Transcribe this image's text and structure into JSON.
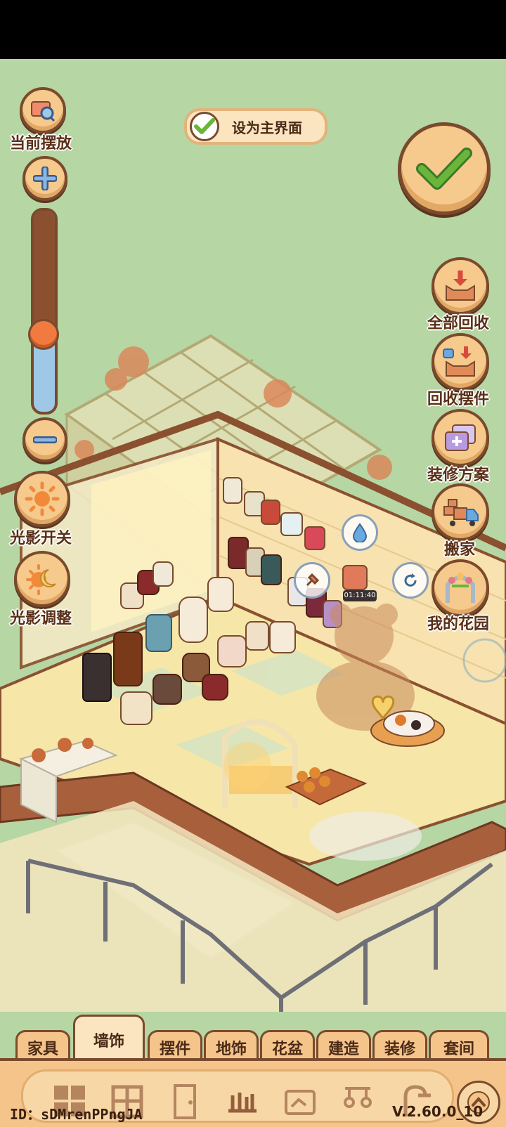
{
  "toolbar_left": {
    "current_label": "当前摆放",
    "light_toggle_label": "光影开关",
    "light_adjust_label": "光影调整"
  },
  "zoom": {
    "level": 0.62
  },
  "set_home": {
    "label": "设为主界面",
    "checked": true
  },
  "toolbar_right": {
    "recycle_all_label": "全部回收",
    "recycle_items_label": "回收摆件",
    "plan_label": "装修方案",
    "move_label": "搬家",
    "garden_label": "我的花园"
  },
  "timer": {
    "text": "01:11:40"
  },
  "tabs": [
    {
      "label": "家具"
    },
    {
      "label": "墙饰",
      "active": true
    },
    {
      "label": "摆件"
    },
    {
      "label": "地饰"
    },
    {
      "label": "花盆"
    },
    {
      "label": "建造"
    },
    {
      "label": "装修"
    },
    {
      "label": "套间"
    }
  ],
  "tray_icons": [
    "grid-icon",
    "window-icon",
    "door-icon",
    "shelf-icon",
    "frame-icon",
    "lamp-icon",
    "shower-icon"
  ],
  "footer": {
    "id_text": "ID：sDMrenPPngJA",
    "version": "V.2.60.0_10"
  },
  "colors": {
    "background": "#b6d6a4",
    "button": "#f6c98d",
    "outline": "#7a4a2c",
    "accent_check": "#6ab53a"
  }
}
